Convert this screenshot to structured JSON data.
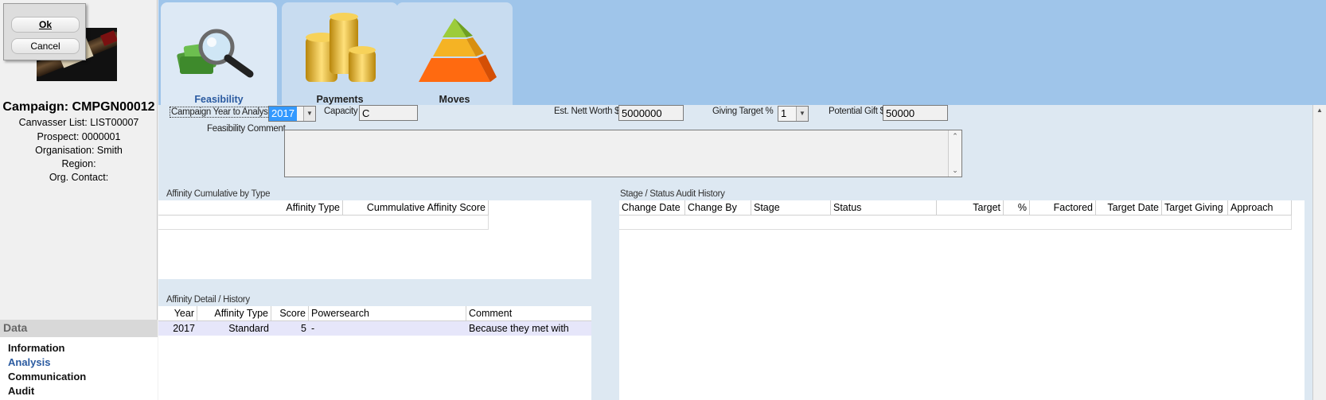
{
  "dialog": {
    "ok_label": "Ok",
    "cancel_label": "Cancel"
  },
  "campaign": {
    "title": "Campaign: CMPGN00012",
    "canvasser_list": "Canvasser List: LIST00007",
    "prospect": "Prospect: 0000001",
    "organisation": "Organisation: Smith",
    "region": "Region:",
    "org_contact": "Org. Contact:"
  },
  "data_nav": {
    "header": "Data",
    "items": [
      "Information",
      "Analysis",
      "Communication",
      "Audit"
    ],
    "active": "Analysis"
  },
  "tabs": [
    {
      "label": "Feasibility",
      "icon": "magnifier-money-icon",
      "active": true
    },
    {
      "label": "Payments",
      "icon": "coin-stacks-icon",
      "active": false
    },
    {
      "label": "Moves",
      "icon": "pyramid-icon",
      "active": false
    }
  ],
  "form": {
    "campaign_year_label": "Campaign Year to Analyse",
    "campaign_year_value": "2017",
    "capacity_label": "Capacity",
    "capacity_value": "C",
    "nett_worth_label": "Est. Nett Worth $",
    "nett_worth_value": "5000000",
    "giving_target_label": "Giving Target %",
    "giving_target_value": "1",
    "potential_gift_label": "Potential Gift $",
    "potential_gift_value": "50000",
    "feasibility_comment_label": "Feasibility Comment",
    "feasibility_comment_value": ""
  },
  "affinity_cumulative": {
    "title": "Affinity Cumulative by Type",
    "columns": [
      "Affinity Type",
      "Cummulative Affinity Score"
    ]
  },
  "affinity_detail": {
    "title": "Affinity Detail / History",
    "columns": [
      "Year",
      "Affinity Type",
      "Score",
      "Powersearch",
      "Comment"
    ],
    "rows": [
      [
        "2017",
        "Standard",
        "5",
        "-",
        "Because they met with"
      ]
    ]
  },
  "stage_audit": {
    "title": "Stage / Status Audit History",
    "columns": [
      "Change Date",
      "Change By",
      "Stage",
      "Status",
      "Target",
      "%",
      "Factored",
      "Target Date",
      "Target Giving",
      "Approach"
    ]
  },
  "colors": {
    "topbar": "#9fc5ea",
    "accent": "#2a5aa0",
    "selection": "#3399ff"
  }
}
